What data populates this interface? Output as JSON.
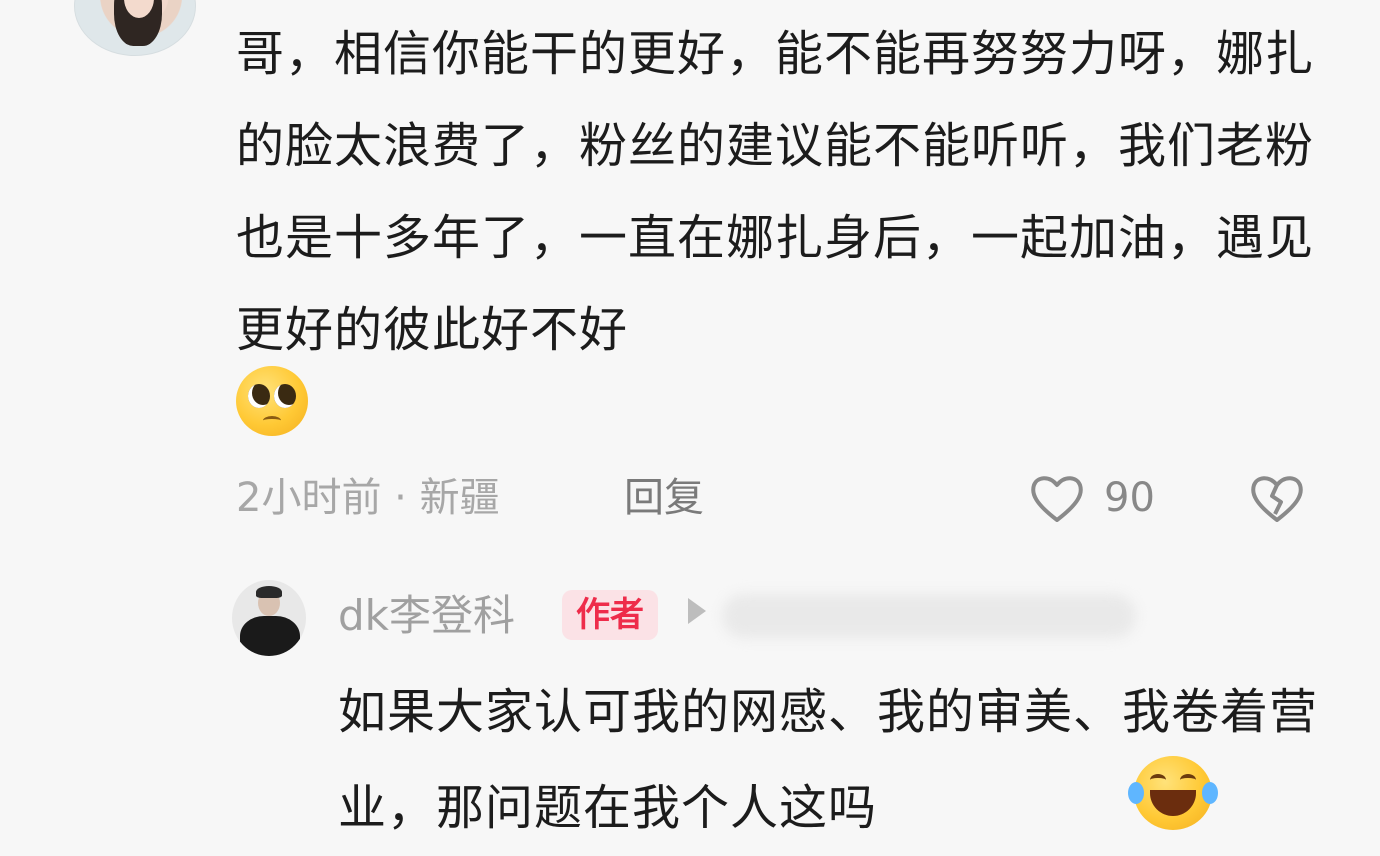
{
  "comment": {
    "text": "哥，相信你能干的更好，能不能再努努力呀，娜扎的脸太浪费了，粉丝的建议能不能听听，我们老粉也是十多年了，一直在娜扎身后，一起加油，遇见更好的彼此好不好",
    "emoji": "pleading-face",
    "meta": "2小时前 · 新疆",
    "reply_label": "回复",
    "like_count": "90"
  },
  "reply": {
    "username": "dk李登科",
    "badge": "作者",
    "text": "如果大家认可我的网感、我的审美、我卷着营业，那问题在我个人这吗",
    "emoji": "tears-of-joy"
  }
}
